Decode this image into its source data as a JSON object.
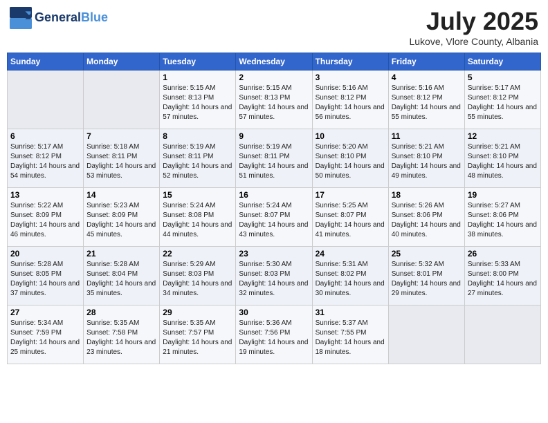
{
  "header": {
    "logo_line1": "General",
    "logo_line2": "Blue",
    "month_year": "July 2025",
    "location": "Lukove, Vlore County, Albania"
  },
  "days_of_week": [
    "Sunday",
    "Monday",
    "Tuesday",
    "Wednesday",
    "Thursday",
    "Friday",
    "Saturday"
  ],
  "weeks": [
    [
      {
        "day": "",
        "info": ""
      },
      {
        "day": "",
        "info": ""
      },
      {
        "day": "1",
        "sunrise": "5:15 AM",
        "sunset": "8:13 PM",
        "daylight": "14 hours and 57 minutes."
      },
      {
        "day": "2",
        "sunrise": "5:15 AM",
        "sunset": "8:13 PM",
        "daylight": "14 hours and 57 minutes."
      },
      {
        "day": "3",
        "sunrise": "5:16 AM",
        "sunset": "8:12 PM",
        "daylight": "14 hours and 56 minutes."
      },
      {
        "day": "4",
        "sunrise": "5:16 AM",
        "sunset": "8:12 PM",
        "daylight": "14 hours and 55 minutes."
      },
      {
        "day": "5",
        "sunrise": "5:17 AM",
        "sunset": "8:12 PM",
        "daylight": "14 hours and 55 minutes."
      }
    ],
    [
      {
        "day": "6",
        "sunrise": "5:17 AM",
        "sunset": "8:12 PM",
        "daylight": "14 hours and 54 minutes."
      },
      {
        "day": "7",
        "sunrise": "5:18 AM",
        "sunset": "8:11 PM",
        "daylight": "14 hours and 53 minutes."
      },
      {
        "day": "8",
        "sunrise": "5:19 AM",
        "sunset": "8:11 PM",
        "daylight": "14 hours and 52 minutes."
      },
      {
        "day": "9",
        "sunrise": "5:19 AM",
        "sunset": "8:11 PM",
        "daylight": "14 hours and 51 minutes."
      },
      {
        "day": "10",
        "sunrise": "5:20 AM",
        "sunset": "8:10 PM",
        "daylight": "14 hours and 50 minutes."
      },
      {
        "day": "11",
        "sunrise": "5:21 AM",
        "sunset": "8:10 PM",
        "daylight": "14 hours and 49 minutes."
      },
      {
        "day": "12",
        "sunrise": "5:21 AM",
        "sunset": "8:10 PM",
        "daylight": "14 hours and 48 minutes."
      }
    ],
    [
      {
        "day": "13",
        "sunrise": "5:22 AM",
        "sunset": "8:09 PM",
        "daylight": "14 hours and 46 minutes."
      },
      {
        "day": "14",
        "sunrise": "5:23 AM",
        "sunset": "8:09 PM",
        "daylight": "14 hours and 45 minutes."
      },
      {
        "day": "15",
        "sunrise": "5:24 AM",
        "sunset": "8:08 PM",
        "daylight": "14 hours and 44 minutes."
      },
      {
        "day": "16",
        "sunrise": "5:24 AM",
        "sunset": "8:07 PM",
        "daylight": "14 hours and 43 minutes."
      },
      {
        "day": "17",
        "sunrise": "5:25 AM",
        "sunset": "8:07 PM",
        "daylight": "14 hours and 41 minutes."
      },
      {
        "day": "18",
        "sunrise": "5:26 AM",
        "sunset": "8:06 PM",
        "daylight": "14 hours and 40 minutes."
      },
      {
        "day": "19",
        "sunrise": "5:27 AM",
        "sunset": "8:06 PM",
        "daylight": "14 hours and 38 minutes."
      }
    ],
    [
      {
        "day": "20",
        "sunrise": "5:28 AM",
        "sunset": "8:05 PM",
        "daylight": "14 hours and 37 minutes."
      },
      {
        "day": "21",
        "sunrise": "5:28 AM",
        "sunset": "8:04 PM",
        "daylight": "14 hours and 35 minutes."
      },
      {
        "day": "22",
        "sunrise": "5:29 AM",
        "sunset": "8:03 PM",
        "daylight": "14 hours and 34 minutes."
      },
      {
        "day": "23",
        "sunrise": "5:30 AM",
        "sunset": "8:03 PM",
        "daylight": "14 hours and 32 minutes."
      },
      {
        "day": "24",
        "sunrise": "5:31 AM",
        "sunset": "8:02 PM",
        "daylight": "14 hours and 30 minutes."
      },
      {
        "day": "25",
        "sunrise": "5:32 AM",
        "sunset": "8:01 PM",
        "daylight": "14 hours and 29 minutes."
      },
      {
        "day": "26",
        "sunrise": "5:33 AM",
        "sunset": "8:00 PM",
        "daylight": "14 hours and 27 minutes."
      }
    ],
    [
      {
        "day": "27",
        "sunrise": "5:34 AM",
        "sunset": "7:59 PM",
        "daylight": "14 hours and 25 minutes."
      },
      {
        "day": "28",
        "sunrise": "5:35 AM",
        "sunset": "7:58 PM",
        "daylight": "14 hours and 23 minutes."
      },
      {
        "day": "29",
        "sunrise": "5:35 AM",
        "sunset": "7:57 PM",
        "daylight": "14 hours and 21 minutes."
      },
      {
        "day": "30",
        "sunrise": "5:36 AM",
        "sunset": "7:56 PM",
        "daylight": "14 hours and 19 minutes."
      },
      {
        "day": "31",
        "sunrise": "5:37 AM",
        "sunset": "7:55 PM",
        "daylight": "14 hours and 18 minutes."
      },
      {
        "day": "",
        "info": ""
      },
      {
        "day": "",
        "info": ""
      }
    ]
  ],
  "labels": {
    "sunrise": "Sunrise:",
    "sunset": "Sunset:",
    "daylight": "Daylight:"
  }
}
